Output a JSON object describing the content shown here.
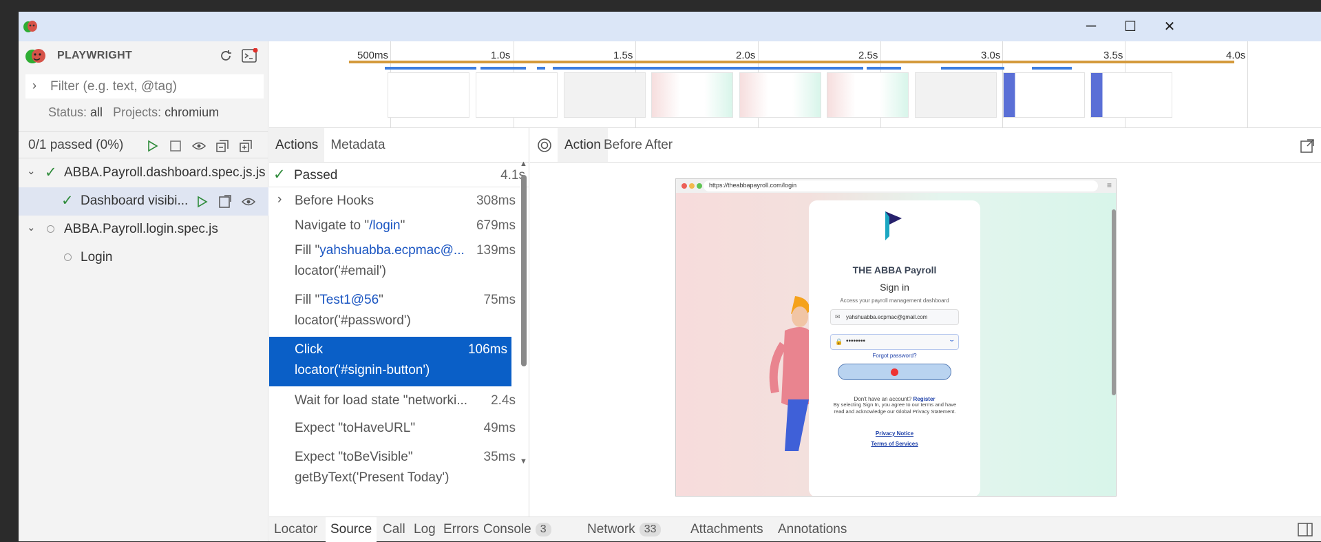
{
  "window": {
    "minimize": "─",
    "maximize": "☐",
    "close": "✕"
  },
  "sidebar": {
    "title": "PLAYWRIGHT",
    "filter_placeholder": "Filter (e.g. text, @tag)",
    "status_label": "Status:",
    "status_value": "all",
    "projects_label": "Projects:",
    "projects_value": "chromium",
    "summary": "0/1 passed (0%)",
    "tree": [
      {
        "label": "ABBA.Payroll.dashboard.spec.js.js",
        "status": "passed"
      },
      {
        "label": "Dashboard visibi...",
        "status": "passed"
      },
      {
        "label": "ABBA.Payroll.login.spec.js",
        "status": "none"
      },
      {
        "label": "Login",
        "status": "none"
      }
    ]
  },
  "timeline": {
    "ticks": [
      "500ms",
      "1.0s",
      "1.5s",
      "2.0s",
      "2.5s",
      "3.0s",
      "3.5s",
      "4.0s"
    ]
  },
  "actions_pane": {
    "tabs": [
      "Actions",
      "Metadata"
    ],
    "passed_label": "Passed",
    "passed_duration": "4.1s",
    "rows": [
      {
        "t1a": "Before Hooks",
        "dur": "308ms"
      },
      {
        "t1a": "Navigate to \"",
        "t1b": "/login",
        "t1c": "\"",
        "dur": "679ms"
      },
      {
        "t1a": "Fill \"",
        "t1b": "yahshuabba.ecpmac@...",
        "t2": "locator('#email')",
        "dur": "139ms"
      },
      {
        "t1a": "Fill \"",
        "t1b": "Test1@56",
        "t1c": "\"",
        "t2": "locator('#password')",
        "dur": "75ms"
      },
      {
        "t1a": "Click",
        "t2": "locator('#signin-button')",
        "dur": "106ms"
      },
      {
        "t1a": "Wait for load state \"networki...",
        "dur": "2.4s"
      },
      {
        "t1a": "Expect \"toHaveURL\"",
        "dur": "49ms"
      },
      {
        "t1a": "Expect \"toBeVisible\"",
        "t2": "getByText('Present Today')",
        "dur": "35ms"
      }
    ]
  },
  "preview": {
    "tabs": [
      "Action",
      "Before",
      "After"
    ],
    "url": "https://theabbapayroll.com/login",
    "brand": "THE ABBA Payroll",
    "heading": "Sign in",
    "subheading": "Access your payroll management dashboard",
    "email_value": "yahshuabba.ecpmac@gmail.com",
    "password_value": "••••••••",
    "forgot": "Forgot password?",
    "no_account": "Don't have an account?",
    "register": "Register",
    "fine_print": "By selecting Sign In, you agree to our terms and have read and acknowledge our Global Privacy Statement.",
    "privacy": "Privacy Notice",
    "terms": "Terms of Services"
  },
  "bottom_tabs": {
    "locator": "Locator",
    "source": "Source",
    "call": "Call",
    "log": "Log",
    "errors": "Errors",
    "console": "Console",
    "console_count": "3",
    "network": "Network",
    "network_count": "33",
    "attachments": "Attachments",
    "annotations": "Annotations"
  },
  "colors": {
    "accent": "#0a5fc7",
    "passed": "#2e8b3a",
    "timeline_orange": "#d49a3c",
    "timeline_blue": "#3b7de0"
  }
}
